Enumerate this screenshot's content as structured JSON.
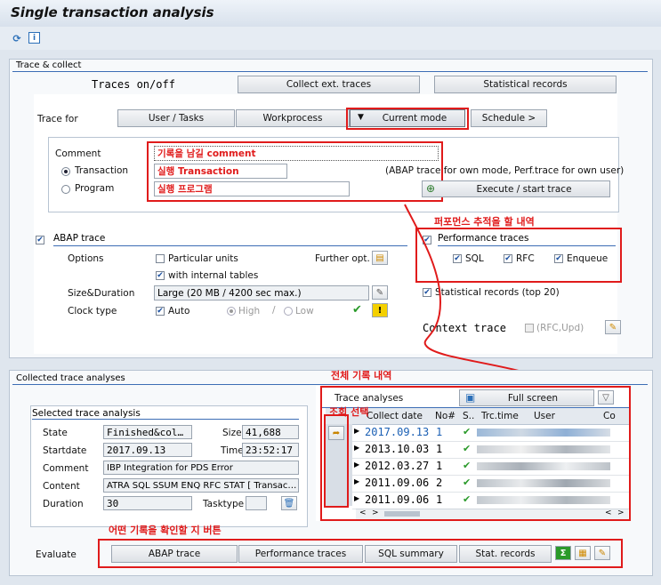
{
  "window": {
    "title": "Single transaction analysis"
  },
  "toolbar": {
    "icons": [
      "refresh-icon",
      "info-icon"
    ]
  },
  "trace_collect": {
    "title": "Trace & collect",
    "traces_onoff": "Traces on/off",
    "collect_btn": "Collect ext. traces",
    "stat_btn": "Statistical records",
    "trace_for": "Trace for",
    "tabs": [
      "User / Tasks",
      "Workprocess",
      "Current mode",
      "Schedule >"
    ],
    "comment_label": "Comment",
    "comment_value": "기록을 남길 comment",
    "transaction_label": "Transaction",
    "transaction_value": "실행 Transaction",
    "program_label": "Program",
    "program_value": "실행 프로그램",
    "abap_note": "(ABAP trace for own mode, Perf.trace for own user)",
    "execute_btn": "Execute / start trace",
    "abap_trace": {
      "title": "ABAP trace",
      "options": "Options",
      "particular": "Particular units",
      "further": "Further opt.",
      "internal": "with internal tables",
      "size_label": "Size&Duration",
      "size_value": "Large (20 MB / 4200 sec max.)",
      "clock_label": "Clock type",
      "auto": "Auto",
      "high": "High",
      "slash": "/",
      "low": "Low"
    },
    "perf": {
      "annotation": "퍼포먼스 추적을 할 내역",
      "title": "Performance traces",
      "sql": "SQL",
      "rfc": "RFC",
      "enqueue": "Enqueue",
      "stat_records": "Statistical records (top 20)",
      "context_trace": "Context trace",
      "context_opt": "(RFC,Upd)"
    }
  },
  "collected": {
    "title": "Collected trace analyses",
    "annotation_all": "전체 기록 내역",
    "annotation_select": "조회 선택",
    "selected": {
      "title": "Selected trace analysis",
      "state_label": "State",
      "state_value": "Finished&col…",
      "size_label": "Size",
      "size_value": "41,688",
      "startdate_label": "Startdate",
      "startdate_value": "2017.09.13",
      "time_label": "Time",
      "time_value": "23:52:17",
      "comment_label": "Comment",
      "comment_value": "IBP Integration for PDS Error",
      "content_label": "Content",
      "content_value": "ATRA SQL SSUM ENQ RFC STAT [ Transac…",
      "duration_label": "Duration",
      "duration_value": "30",
      "tasktype_label": "Tasktype"
    },
    "analyses": {
      "title": "Trace analyses",
      "fullscreen": "Full screen",
      "headers": [
        "Collect date",
        "No#",
        "S..",
        "Trc.time",
        "User",
        "Co"
      ],
      "rows": [
        {
          "date": "2017.09.13",
          "no": "1"
        },
        {
          "date": "2013.10.03",
          "no": "1"
        },
        {
          "date": "2012.03.27",
          "no": "1"
        },
        {
          "date": "2011.09.06",
          "no": "2"
        },
        {
          "date": "2011.09.06",
          "no": "1"
        }
      ]
    }
  },
  "evaluate": {
    "annotation": "어떤 기록을 확인할 지 버튼",
    "label": "Evaluate",
    "buttons": [
      "ABAP trace",
      "Performance traces",
      "SQL summary",
      "Stat. records"
    ]
  },
  "colors": {
    "annotation_red": "#e01b1b",
    "link_blue": "#1a5fb4",
    "check_green": "#2a9a2a"
  }
}
